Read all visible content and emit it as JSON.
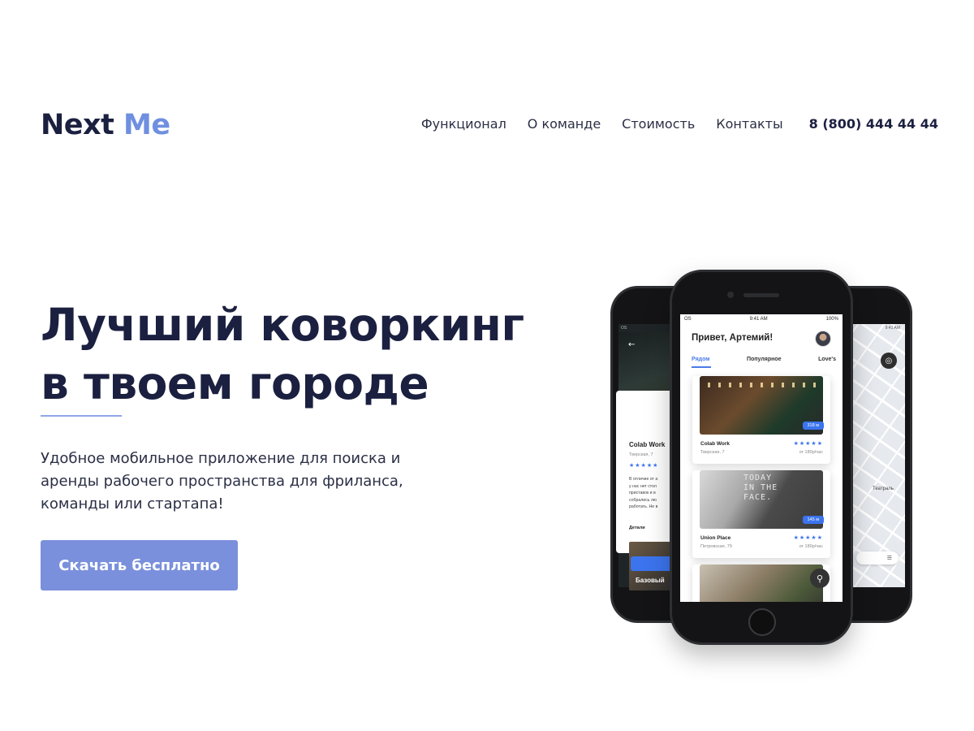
{
  "header": {
    "logo_part1": "Next",
    "logo_part2": "Me",
    "nav": [
      "Функционал",
      "О команде",
      "Стоимость",
      "Контакты"
    ],
    "phone": "8 (800) 444 44 44"
  },
  "hero": {
    "title_line1": "Лучший коворкинг",
    "title_line2": "в твоем городе",
    "description": "Удобное мобильное приложение для поиска и аренды рабочего пространства для фриланса, команды или стартапа!",
    "cta_label": "Скачать бесплатно"
  },
  "app_main": {
    "status_carrier": "OS",
    "status_time": "9:41 AM",
    "status_battery": "100%",
    "greeting": "Привет, Артемий!",
    "tabs": [
      "Рядом",
      "Популярное",
      "Love's"
    ],
    "cards": [
      {
        "distance": "318 м",
        "name": "Colab Work",
        "address": "Тверская, 7",
        "rating": "★★★★★",
        "price": "от 180р/час"
      },
      {
        "distance": "145 м",
        "name": "Union Place",
        "address": "Петровская, 79",
        "rating": "★★★★★",
        "price": "от 180р/час",
        "wall_text": [
          "TODAY",
          "IN THE",
          "FACE."
        ]
      }
    ],
    "pin_icon": "map-pin-icon"
  },
  "app_left": {
    "status": "OS",
    "name": "Colab Work",
    "address": "Тверская, 7",
    "rating": "★★★★★",
    "description_lines": [
      "В отличие от а",
      "у нас нет стол",
      "приставок и в",
      "собрались лю",
      "работать. Не в"
    ],
    "details_label": "Детали",
    "plan_label": "Базовый"
  },
  "app_right": {
    "status_time": "9:41 AM",
    "map_label": "Театраль"
  },
  "colors": {
    "brand_dark": "#1b2040",
    "brand_accent": "#6f8fe0",
    "cta_bg": "#7a90dc",
    "app_blue": "#3c74ee"
  }
}
